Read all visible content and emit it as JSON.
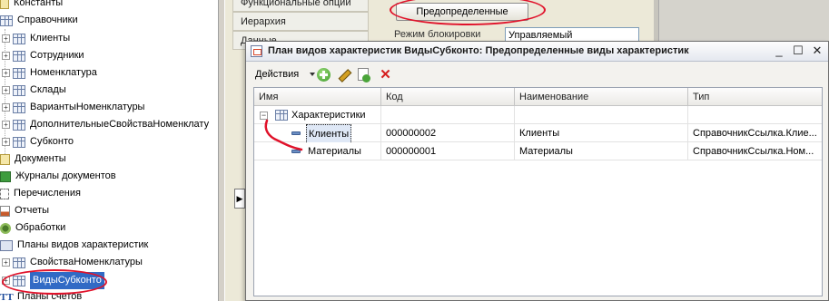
{
  "tree": {
    "items": [
      {
        "label": "Константы",
        "icon": "constants-icon"
      },
      {
        "label": "Справочники",
        "icon": "catalogs-icon"
      },
      {
        "label": "Клиенты",
        "icon": "table-icon"
      },
      {
        "label": "Сотрудники",
        "icon": "table-icon"
      },
      {
        "label": "Номенклатура",
        "icon": "table-icon"
      },
      {
        "label": "Склады",
        "icon": "table-icon"
      },
      {
        "label": "ВариантыНоменклатуры",
        "icon": "table-icon"
      },
      {
        "label": "ДополнительныеСвойстваНоменклату",
        "icon": "table-icon"
      },
      {
        "label": "Субконто",
        "icon": "table-icon"
      },
      {
        "label": "Документы",
        "icon": "document-icon"
      },
      {
        "label": "Журналы документов",
        "icon": "journal-icon"
      },
      {
        "label": "Перечисления",
        "icon": "enum-icon"
      },
      {
        "label": "Отчеты",
        "icon": "report-icon"
      },
      {
        "label": "Обработки",
        "icon": "processing-icon"
      },
      {
        "label": "Планы видов характеристик",
        "icon": "chart-of-characteristics-icon"
      },
      {
        "label": "СвойстваНоменклатуры",
        "icon": "table-icon"
      },
      {
        "label": "ВидыСубконто",
        "icon": "table-icon"
      },
      {
        "label": "Планы счетов",
        "icon": "chart-of-accounts-icon"
      }
    ]
  },
  "props": {
    "tabs": [
      "Функциональные опции",
      "Иерархия",
      "Данные"
    ],
    "predefined_button": "Предопределенные",
    "lock_mode_label": "Режим блокировки",
    "lock_mode_value": "Управляемый"
  },
  "window": {
    "title": "План видов характеристик ВидыСубконто: Предопределенные виды характеристик",
    "toolbar": {
      "actions_label": "Действия"
    },
    "columns": [
      "Имя",
      "Код",
      "Наименование",
      "Тип"
    ],
    "group_row": {
      "name": "Характеристики"
    },
    "rows": [
      {
        "name": "Клиенты",
        "code": "000000002",
        "description": "Клиенты",
        "type": "СправочникСсылка.Клие..."
      },
      {
        "name": "Материалы",
        "code": "000000001",
        "description": "Материалы",
        "type": "СправочникСсылка.Ном..."
      }
    ]
  },
  "colors": {
    "accent": "#316ac5",
    "annotation": "#e0122a"
  }
}
